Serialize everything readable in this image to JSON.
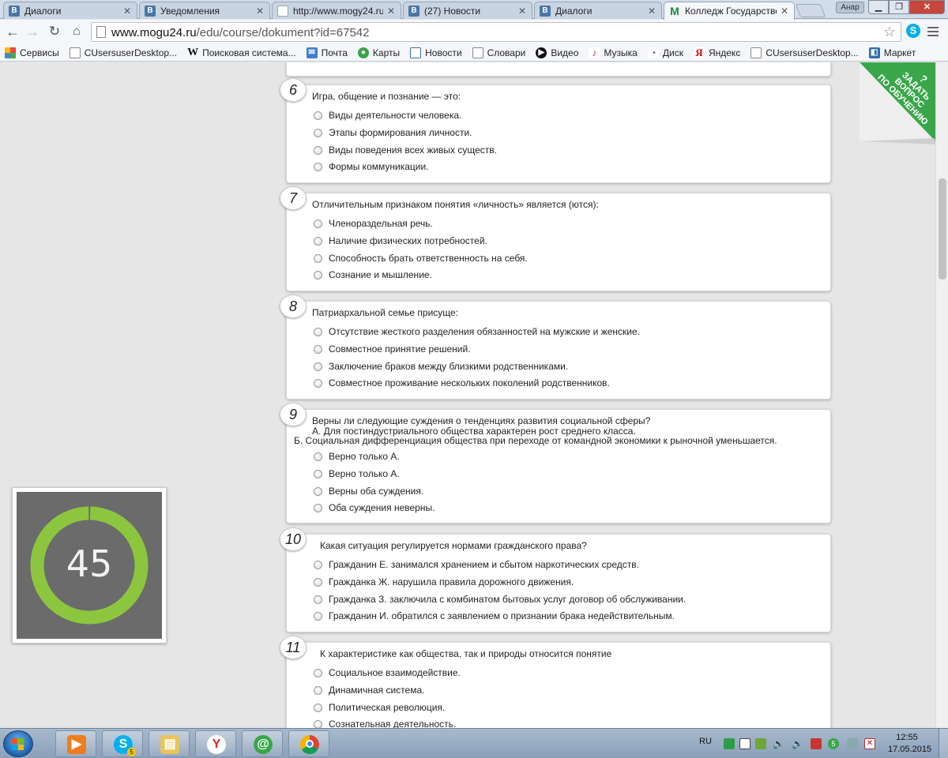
{
  "browser": {
    "tabs": [
      {
        "title": "Диалоги",
        "icon": "vk-icon"
      },
      {
        "title": "Уведомления",
        "icon": "vk-icon"
      },
      {
        "title": "http://www.mogy24.ru/",
        "icon": "page-icon"
      },
      {
        "title": "(27) Новости",
        "icon": "vk-icon"
      },
      {
        "title": "Диалоги",
        "icon": "vk-icon"
      },
      {
        "title": "Колледж Государственн",
        "icon": "mogu-icon"
      }
    ],
    "profile_label": "Анар",
    "url_host": "www.mogu24.ru",
    "url_path": "/edu/course/dokument?id=67542"
  },
  "bookmarks": [
    {
      "label": "Сервисы",
      "icon": "apps-icon"
    },
    {
      "label": "CUsersuserDesktop...",
      "icon": "file-icon"
    },
    {
      "label": "Поисковая система...",
      "icon": "wikipedia-icon"
    },
    {
      "label": "Почта",
      "icon": "mail-icon"
    },
    {
      "label": "Карты",
      "icon": "maps-icon"
    },
    {
      "label": "Новости",
      "icon": "news-icon"
    },
    {
      "label": "Словари",
      "icon": "file-icon"
    },
    {
      "label": "Видео",
      "icon": "video-icon"
    },
    {
      "label": "Музыка",
      "icon": "music-icon"
    },
    {
      "label": "Диск",
      "icon": "disk-icon"
    },
    {
      "label": "Яндекс",
      "icon": "yandex-icon"
    },
    {
      "label": "CUsersuserDesktop...",
      "icon": "file-icon"
    },
    {
      "label": "Маркет",
      "icon": "market-icon"
    }
  ],
  "ask_badge": {
    "q": "?",
    "line1": "ЗАДАТЬ",
    "line2": "ВОПРОС",
    "line3": "ПО ОБУЧЕНИЮ",
    "color": "#3aa64a"
  },
  "questions": [
    {
      "num": "6",
      "text": "Игра, общение и познание — это:",
      "options": [
        "Виды деятельности человека.",
        "Этапы формирования личности.",
        "Виды поведения всех живых существ.",
        "Формы коммуникации."
      ]
    },
    {
      "num": "7",
      "text": "Отличительным признаком понятия «личность» является (ются):",
      "options": [
        "Членораздельная речь.",
        "Наличие физических потребностей.",
        "Способность брать ответственность на себя.",
        "Сознание и мышление."
      ]
    },
    {
      "num": "8",
      "text": "Патриархальной семье присуще:",
      "options": [
        "Отсутствие жесткого разделения обязанностей на мужские и женские.",
        "Совместное принятие решений.",
        "Заключение браков между близкими родственниками.",
        "Совместное проживание нескольких поколений родственников."
      ]
    },
    {
      "num": "9",
      "text": "Верны ли следующие суждения о тенденциях развития социальной сферы?",
      "sub1": "А. Для постиндустриального общества характерен рост среднего класса.",
      "sub2": "Б. Социальная дифференциация общества при переходе от командной экономики к рыночной уменьшается.",
      "options": [
        "Верно только А.",
        "Верно только А.",
        "Верны оба суждения.",
        "Оба суждения неверны."
      ]
    },
    {
      "num": "10",
      "text": "Какая ситуация регулируется нормами гражданского права?",
      "options": [
        "Гражданин Е. занимался хранением и сбытом наркотических средств.",
        "Гражданка Ж. нарушила правила дорожного движения.",
        "Гражданка З. заключила с комбинатом бытовых услуг договор об обслуживании.",
        "Гражданин И. обратился с заявлением о признании брака недействительным."
      ]
    },
    {
      "num": "11",
      "text": "К характеристике как общества, так и природы относится понятие",
      "options": [
        "Социальное взаимодействие.",
        "Динамичная система.",
        "Политическая революция.",
        "Сознательная деятельность."
      ]
    }
  ],
  "timer": {
    "value": "45",
    "fraction": 0.995,
    "ring_color": "#8cc63f",
    "track_color": "#6b6b6b"
  },
  "taskbar": {
    "apps": [
      "media-player-icon",
      "skype-icon",
      "file-explorer-icon",
      "yandex-browser-icon",
      "mail-agent-icon",
      "chrome-icon"
    ],
    "skype_badge": "5",
    "lang": "RU",
    "tray_badge": "5",
    "time": "12:55",
    "date": "17.05.2015"
  }
}
